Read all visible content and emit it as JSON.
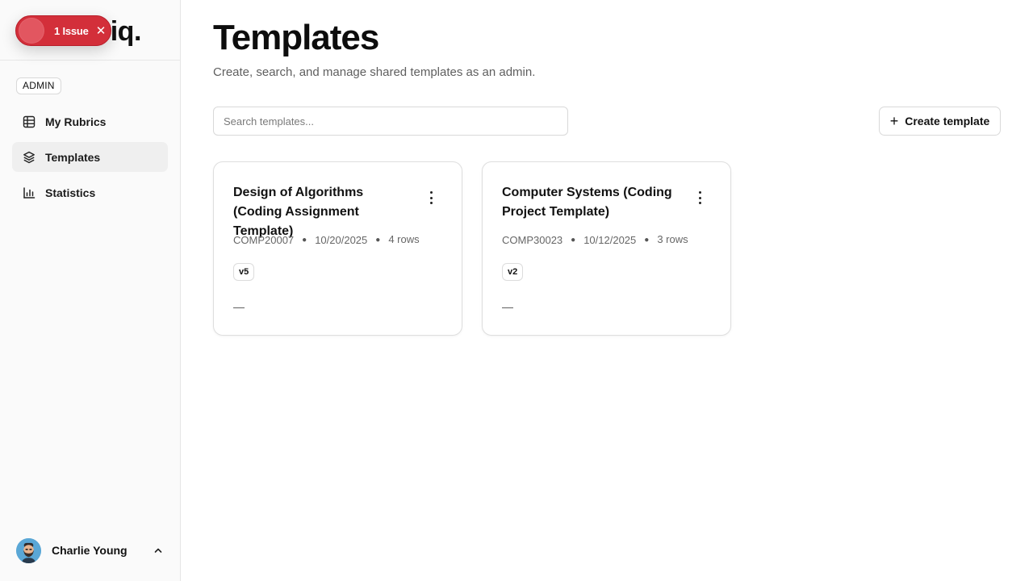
{
  "colors": {
    "issue_red": "#d32f3a",
    "sidebar_bg": "#fafafa",
    "active_nav_bg": "#efefef",
    "border": "#dedede"
  },
  "brand": {
    "visible_text": "riq."
  },
  "issue_badge": {
    "label": "1 Issue",
    "close_icon": "x-icon"
  },
  "sidebar": {
    "role_badge": "ADMIN",
    "items": [
      {
        "label": "My Rubrics",
        "icon": "table-icon",
        "active": false
      },
      {
        "label": "Templates",
        "icon": "templates-icon",
        "active": true
      },
      {
        "label": "Statistics",
        "icon": "bar-chart-icon",
        "active": false
      }
    ],
    "user": {
      "name": "Charlie Young",
      "caret_icon": "chevron-up-icon"
    }
  },
  "main": {
    "title": "Templates",
    "subtitle": "Create, search, and manage shared templates as an admin.",
    "search": {
      "placeholder": "Search templates...",
      "value": ""
    },
    "create_button": {
      "icon": "plus-icon",
      "label": "Create template"
    },
    "templates": [
      {
        "title": "Design of Algorithms (Coding Assignment Template)",
        "code": "COMP20007",
        "date": "10/20/2025",
        "rows_label": "4 rows",
        "version": "v5",
        "footer": "—",
        "menu_icon": "more-vertical-icon"
      },
      {
        "title": "Computer Systems (Coding Project Template)",
        "code": "COMP30023",
        "date": "10/12/2025",
        "rows_label": "3 rows",
        "version": "v2",
        "footer": "—",
        "menu_icon": "more-vertical-icon"
      }
    ]
  }
}
